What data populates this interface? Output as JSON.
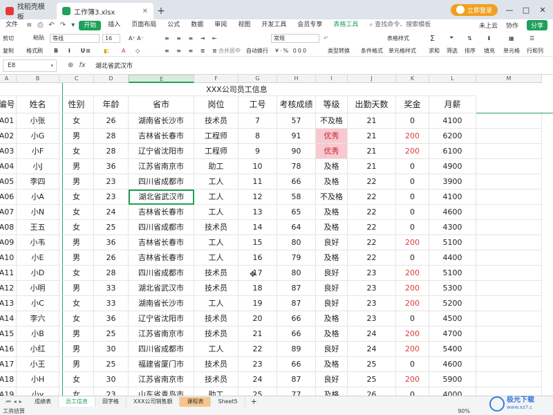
{
  "titlebar": {
    "tabs": [
      {
        "label": "找稻壳模板",
        "color": "#e53935"
      },
      {
        "label": "工作簿3.xlsx",
        "color": "#1fa15b"
      }
    ],
    "new_tab": "+",
    "signin_label": "立即登录",
    "window_buttons": [
      "—",
      "□",
      "✕"
    ]
  },
  "menubar": {
    "left_items": [
      "文件",
      "≡",
      "⎙",
      "↶",
      "↷",
      "▾"
    ],
    "items": [
      "开始",
      "插入",
      "页面布局",
      "公式",
      "数据",
      "审阅",
      "视图",
      "开发工具",
      "会员专享",
      "表格工具"
    ],
    "active": "开始",
    "search": "查找命令、搜索模板",
    "right_items": [
      "未上云",
      "协作"
    ],
    "share": "分享"
  },
  "toolbar": {
    "clipboard": [
      "剪切",
      "复制",
      "格式刷"
    ],
    "paste": "粘贴",
    "font_name": "等线",
    "font_size": "16",
    "number_format": "常规",
    "merge": "合并居中",
    "wrap": "自动换行",
    "convert": "类型转换",
    "cond_format": "条件格式",
    "table_style": "表格样式",
    "cell_style": "单元格样式",
    "sum": "求和",
    "filter": "筛选",
    "sort": "排序",
    "fill": "填充",
    "cell": "单元格",
    "rowcol": "行和列"
  },
  "formula_bar": {
    "name_box": "E8",
    "fx": "fx",
    "content": "湖北省武汉市"
  },
  "columns": [
    "A",
    "B",
    "C",
    "D",
    "E",
    "F",
    "G",
    "H",
    "I",
    "J",
    "K",
    "L",
    "M"
  ],
  "selected_column": "E",
  "table": {
    "title": "XXX公司员工信息",
    "headers": [
      "编号",
      "姓名",
      "性别",
      "年龄",
      "省市",
      "岗位",
      "工号",
      "考核成绩",
      "等级",
      "出勤天数",
      "奖金",
      "月薪"
    ],
    "rows": [
      [
        "A01",
        "小张",
        "女",
        "26",
        "湖南省长沙市",
        "技术员",
        "7",
        "57",
        "不及格",
        "21",
        "0",
        "4100"
      ],
      [
        "A02",
        "小G",
        "男",
        "28",
        "吉林省长春市",
        "工程师",
        "8",
        "91",
        "优秀",
        "21",
        "200",
        "6200"
      ],
      [
        "A03",
        "小F",
        "女",
        "28",
        "辽宁省沈阳市",
        "工程师",
        "9",
        "90",
        "优秀",
        "21",
        "200",
        "6100"
      ],
      [
        "A04",
        "小J",
        "男",
        "36",
        "江苏省南京市",
        "助工",
        "10",
        "78",
        "及格",
        "21",
        "0",
        "4900"
      ],
      [
        "A05",
        "李四",
        "男",
        "23",
        "四川省成都市",
        "工人",
        "11",
        "66",
        "及格",
        "22",
        "0",
        "3900"
      ],
      [
        "A06",
        "小A",
        "女",
        "23",
        "湖北省武汉市",
        "工人",
        "12",
        "58",
        "不及格",
        "22",
        "0",
        "4100"
      ],
      [
        "A07",
        "小N",
        "女",
        "24",
        "吉林省长春市",
        "工人",
        "13",
        "65",
        "及格",
        "22",
        "0",
        "4600"
      ],
      [
        "A08",
        "王五",
        "女",
        "25",
        "四川省成都市",
        "技术员",
        "14",
        "64",
        "及格",
        "22",
        "0",
        "4300"
      ],
      [
        "A09",
        "小韦",
        "男",
        "36",
        "吉林省长春市",
        "工人",
        "15",
        "80",
        "良好",
        "22",
        "200",
        "5100"
      ],
      [
        "A10",
        "小E",
        "男",
        "26",
        "吉林省长春市",
        "工人",
        "16",
        "79",
        "及格",
        "22",
        "0",
        "4400"
      ],
      [
        "A11",
        "小D",
        "女",
        "28",
        "四川省成都市",
        "技术员",
        "17",
        "80",
        "良好",
        "23",
        "200",
        "5100"
      ],
      [
        "A12",
        "小明",
        "男",
        "33",
        "湖北省武汉市",
        "技术员",
        "18",
        "87",
        "良好",
        "23",
        "200",
        "5300"
      ],
      [
        "A13",
        "小C",
        "女",
        "33",
        "湖南省长沙市",
        "工人",
        "19",
        "87",
        "良好",
        "23",
        "200",
        "5200"
      ],
      [
        "A14",
        "李六",
        "女",
        "36",
        "辽宁省沈阳市",
        "技术员",
        "20",
        "66",
        "及格",
        "23",
        "0",
        "4500"
      ],
      [
        "A15",
        "小B",
        "男",
        "25",
        "江苏省南京市",
        "技术员",
        "21",
        "66",
        "及格",
        "24",
        "200",
        "4700"
      ],
      [
        "A16",
        "小红",
        "男",
        "30",
        "四川省成都市",
        "工人",
        "22",
        "89",
        "良好",
        "24",
        "200",
        "5400"
      ],
      [
        "A17",
        "小王",
        "男",
        "25",
        "福建省厦门市",
        "技术员",
        "23",
        "66",
        "及格",
        "25",
        "0",
        "4600"
      ],
      [
        "A18",
        "小H",
        "女",
        "30",
        "江苏省南京市",
        "技术员",
        "24",
        "87",
        "良好",
        "25",
        "200",
        "5900"
      ],
      [
        "A19",
        "小y",
        "女",
        "23",
        "山东省青岛市",
        "助工",
        "25",
        "77",
        "及格",
        "26",
        "0",
        "4000"
      ]
    ],
    "highlight": {
      "pink_grade": [
        "优秀"
      ],
      "red_bonus": "200"
    }
  },
  "sheets": {
    "tabs": [
      "成绩表",
      "员工信息",
      "田字格",
      "XXX公司销售额",
      "课程表",
      "Sheet5"
    ],
    "active": "员工信息",
    "add": "+"
  },
  "status": {
    "left": "工资结算",
    "zoom": "90%"
  },
  "watermark": {
    "text": "极光下载",
    "sub": "www.xz7.c"
  },
  "colors": {
    "accent": "#1fa15b",
    "red": "#e03b3b",
    "pink": "#f9c9cf"
  }
}
